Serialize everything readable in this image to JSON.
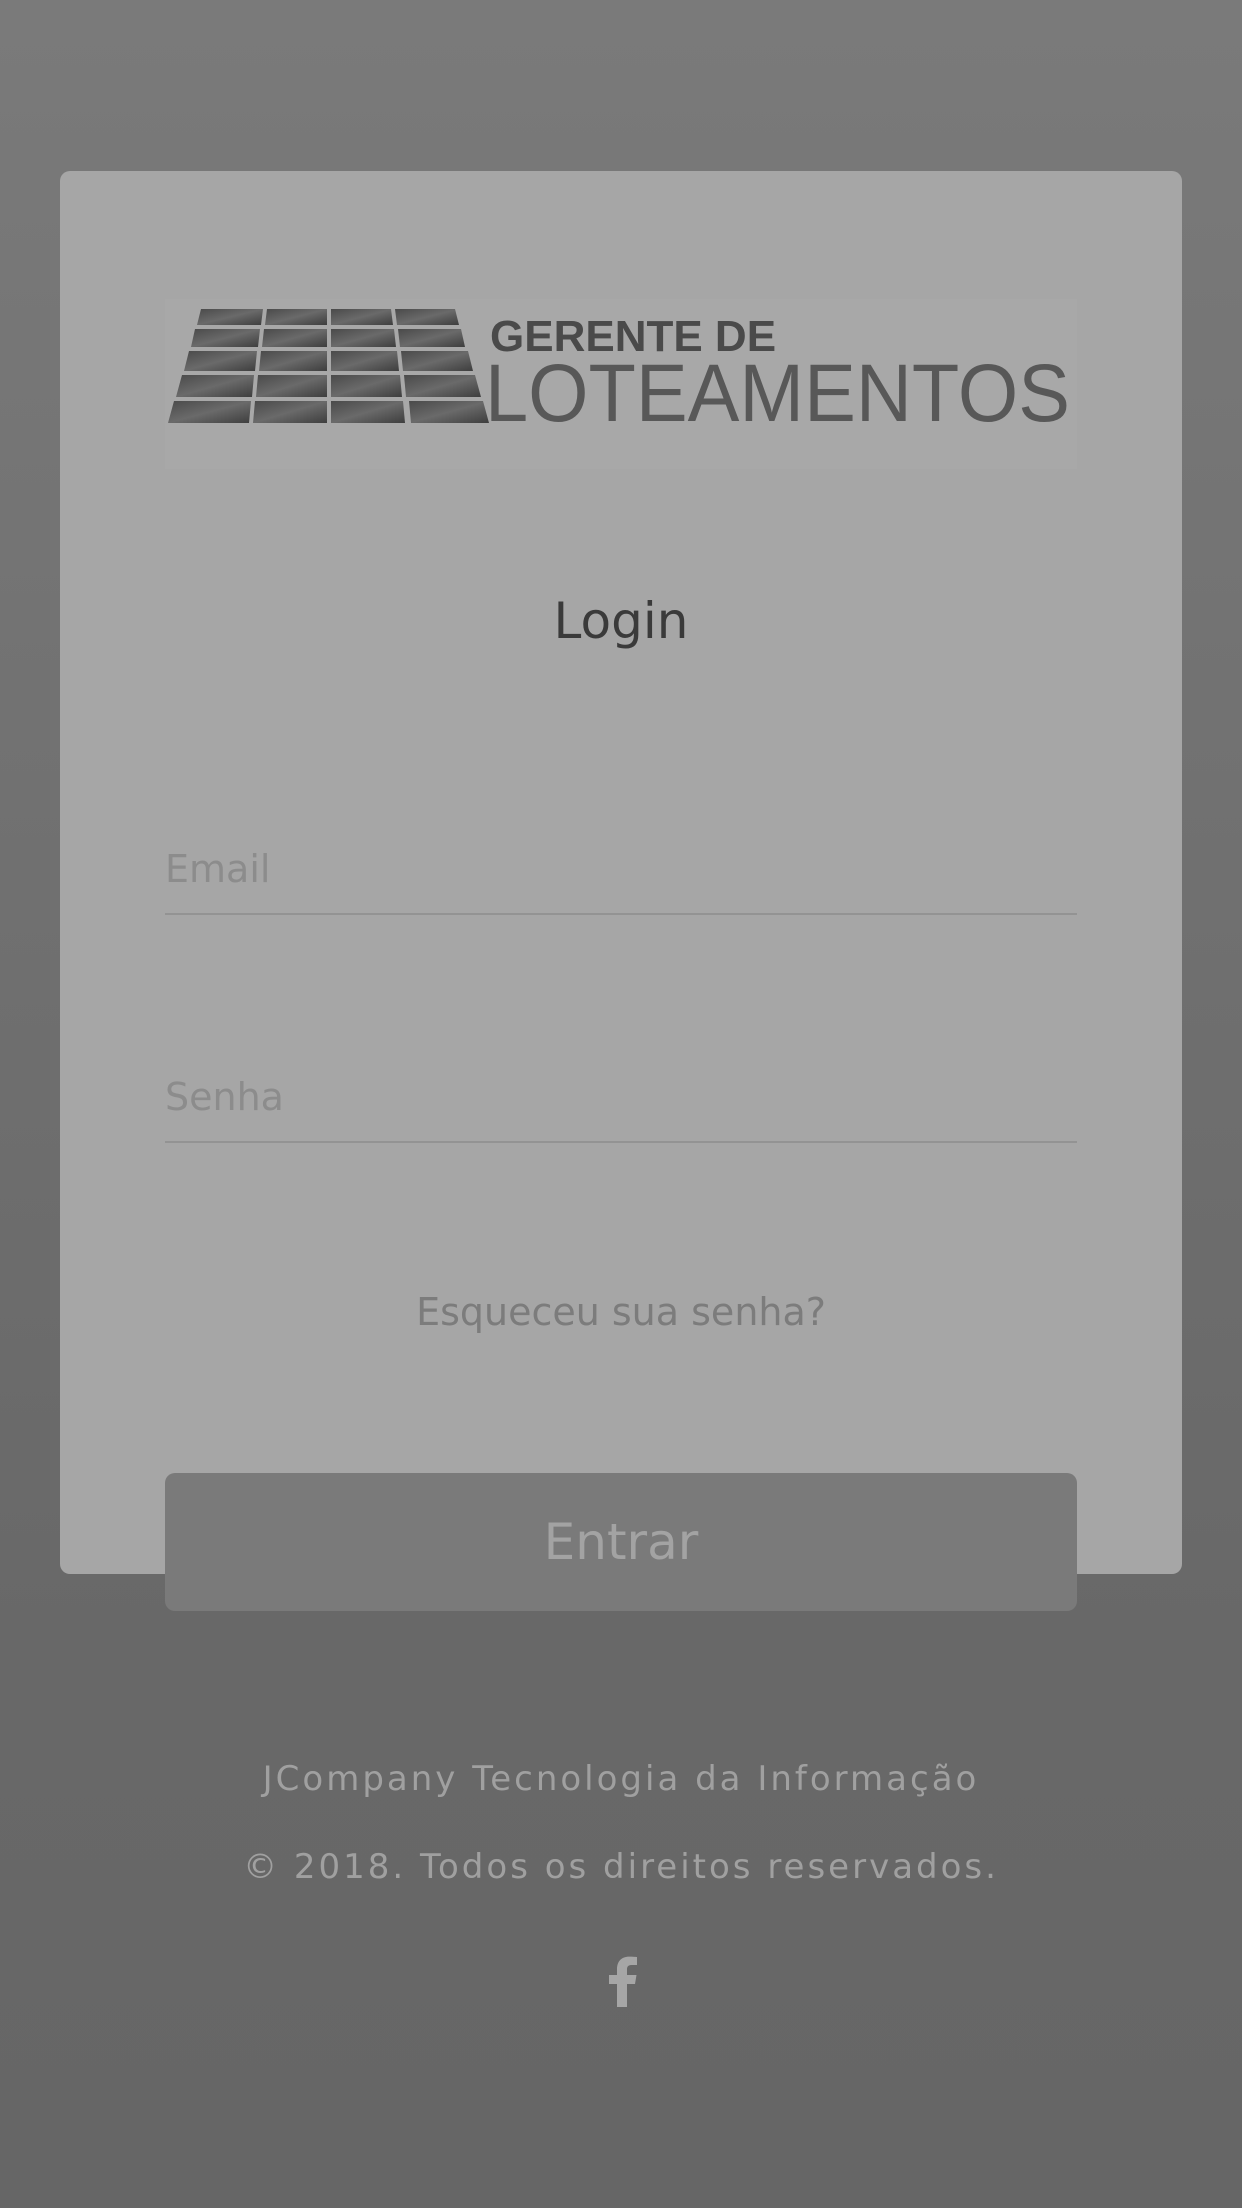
{
  "login": {
    "logo_text_top": "GERENTE DE",
    "logo_text_bottom": "LOTEAMENTOS",
    "title": "Login",
    "email_placeholder": "Email",
    "password_placeholder": "Senha",
    "forgot_password": "Esqueceu sua senha?",
    "submit_label": "Entrar"
  },
  "footer": {
    "company": "JCompany Tecnologia da Informação",
    "copyright": "© 2018. Todos os direitos reservados.",
    "social_icon": "facebook-icon"
  },
  "colors": {
    "page_background": "#6e6e6e",
    "card_background": "#a6a6a6",
    "button_background": "#7a7a7a",
    "title_text": "#3a3a3a"
  }
}
